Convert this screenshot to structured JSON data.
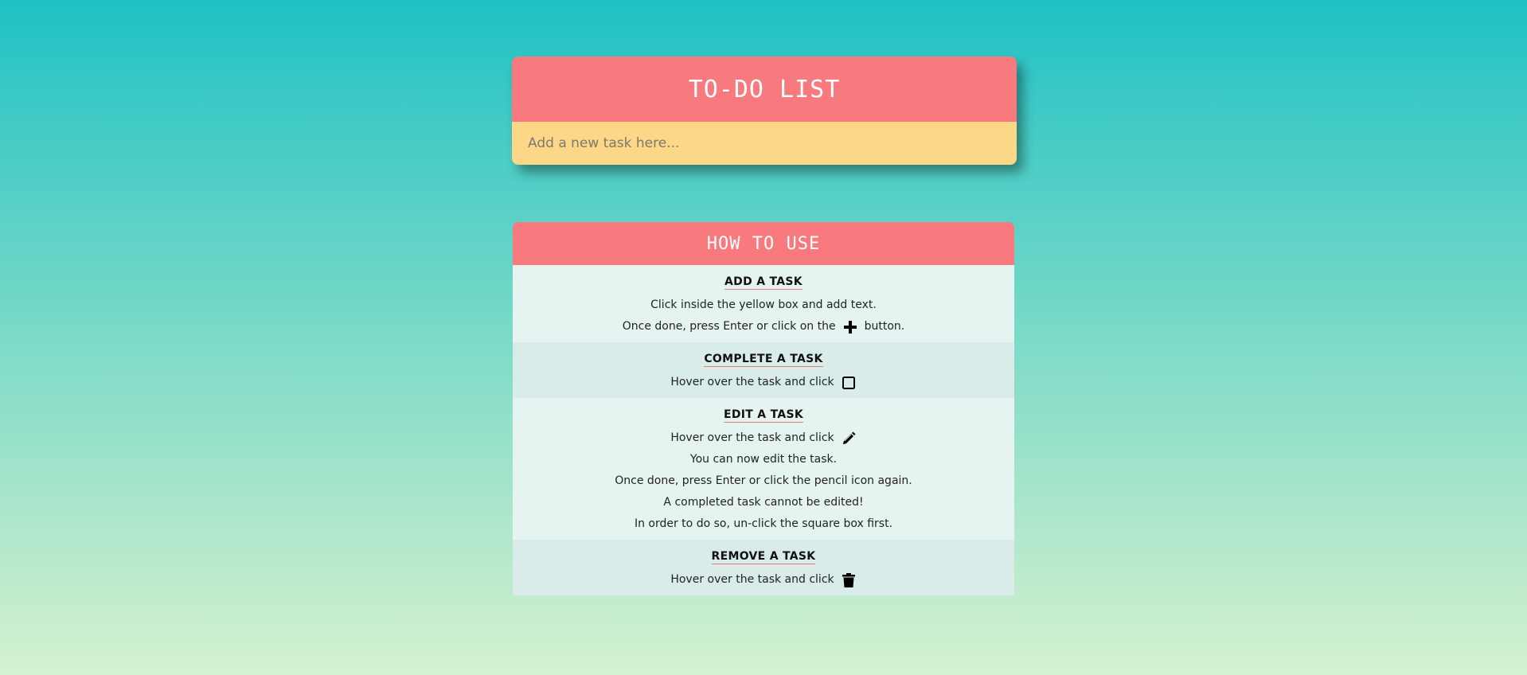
{
  "todo": {
    "title": "TO-DO LIST",
    "input_placeholder": "Add a new task here..."
  },
  "howto": {
    "title": "HOW TO USE",
    "sections": [
      {
        "title": "ADD A TASK",
        "lines": [
          {
            "text": "Click inside the yellow box and add text."
          },
          {
            "before": "Once done, press Enter or click on the",
            "icon": "plus-icon",
            "after": "button."
          }
        ]
      },
      {
        "title": "COMPLETE A TASK",
        "lines": [
          {
            "before": "Hover over the task and click",
            "icon": "square-checkbox-icon"
          }
        ]
      },
      {
        "title": "EDIT A TASK",
        "lines": [
          {
            "before": "Hover over the task and click",
            "icon": "pencil-icon"
          },
          {
            "text": "You can now edit the task."
          },
          {
            "text": "Once done, press Enter or click the pencil icon again."
          },
          {
            "text": "A completed task cannot be edited!"
          },
          {
            "text": "In order to do so, un-click the square box first."
          }
        ]
      },
      {
        "title": "REMOVE A TASK",
        "lines": [
          {
            "before": "Hover over the task and click",
            "icon": "trash-icon"
          }
        ]
      }
    ]
  },
  "colors": {
    "header": "#f87a7e",
    "input_bg": "#fdd788",
    "section_light": "#e6f4f1",
    "section_dark": "#d9ecea"
  }
}
